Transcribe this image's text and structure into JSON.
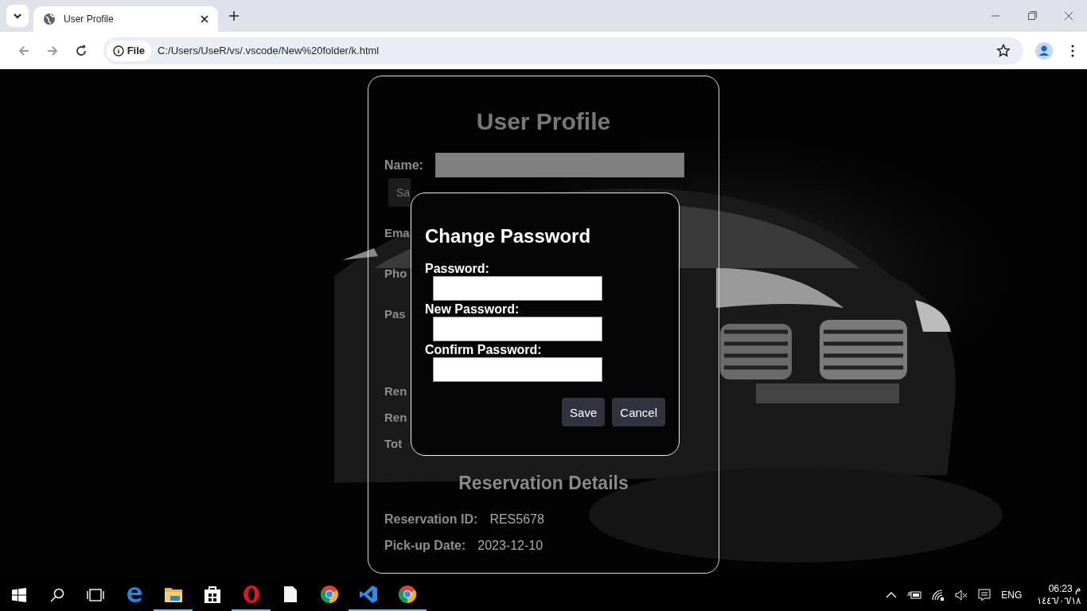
{
  "browser": {
    "tab_title": "User Profile",
    "site_chip": "File",
    "url": "C:/Users/UseR/vs/.vscode/New%20folder/k.html"
  },
  "profile": {
    "title": "User Profile",
    "name_label": "Name:",
    "save_button": "Sa",
    "email_label": "Ema",
    "phone_label": "Pho",
    "password_label": "Pas"
  },
  "rental": {
    "rows": [
      {
        "label": "Ren"
      },
      {
        "label": "Ren"
      },
      {
        "label": "Tot"
      }
    ]
  },
  "reservation": {
    "title": "Reservation Details",
    "rows": [
      {
        "label": "Reservation ID:",
        "value": "RES5678"
      },
      {
        "label": "Pick-up Date:",
        "value": "2023-12-10"
      }
    ]
  },
  "modal": {
    "title": "Change Password",
    "fields": [
      {
        "label": "Password:"
      },
      {
        "label": "New Password:"
      },
      {
        "label": "Confirm Password:"
      }
    ],
    "buttons": [
      {
        "label": "Save"
      },
      {
        "label": "Cancel"
      }
    ]
  },
  "taskbar": {
    "language": "ENG",
    "time": "06:23",
    "period": "م",
    "date": "١٤٤٦/٠٦/١٨",
    "apps": [
      {
        "kind": "edge",
        "running": false
      },
      {
        "kind": "folder",
        "running": true
      },
      {
        "kind": "store",
        "running": false
      },
      {
        "kind": "opera",
        "running": true
      },
      {
        "kind": "file",
        "running": false
      },
      {
        "kind": "chrome",
        "running": false
      },
      {
        "kind": "vscode",
        "running": true
      },
      {
        "kind": "chrome",
        "running": true
      }
    ]
  }
}
